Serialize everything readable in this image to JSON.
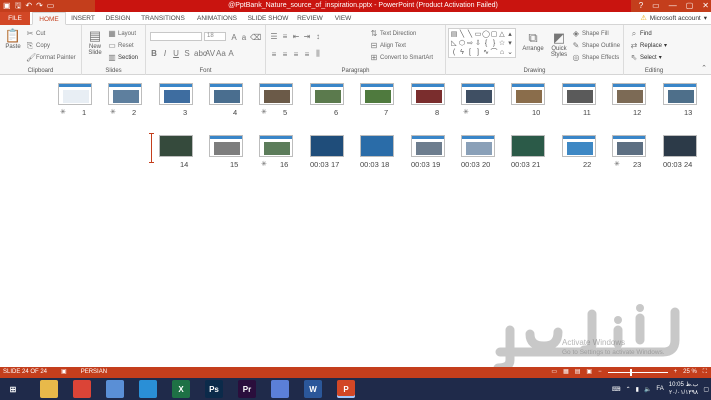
{
  "window": {
    "title": "@PptBank_Nature_source_of_inspiration.pptx - PowerPoint (Product Activation Failed)",
    "controls": [
      "?",
      "▭",
      "—",
      "▢",
      "✕"
    ]
  },
  "tabs": [
    "FILE",
    "HOME",
    "INSERT",
    "DESIGN",
    "TRANSITIONS",
    "ANIMATIONS",
    "SLIDE SHOW",
    "REVIEW",
    "VIEW"
  ],
  "active_tab": "HOME",
  "account_label": "Microsoft account",
  "ribbon": {
    "clipboard": {
      "label": "Clipboard",
      "paste": "Paste",
      "cut": "Cut",
      "copy": "Copy",
      "format_painter": "Format Painter"
    },
    "slides": {
      "label": "Slides",
      "new_slide": "New Slide",
      "layout": "Layout",
      "reset": "Reset",
      "section": "Section"
    },
    "font": {
      "label": "Font",
      "size": "18"
    },
    "paragraph": {
      "label": "Paragraph",
      "text_direction": "Text Direction",
      "align_text": "Align Text",
      "smartart": "Convert to SmartArt"
    },
    "drawing": {
      "label": "Drawing",
      "arrange": "Arrange",
      "quick_styles": "Quick Styles",
      "shape_fill": "Shape Fill",
      "shape_outline": "Shape Outline",
      "shape_effects": "Shape Effects"
    },
    "editing": {
      "label": "Editing",
      "find": "Find",
      "replace": "Replace",
      "select": "Select"
    }
  },
  "slides_row1": [
    {
      "num": "13",
      "theme": "light",
      "pic": "#4e6f8a"
    },
    {
      "num": "12",
      "theme": "light",
      "pic": "#7c6a55"
    },
    {
      "num": "11",
      "theme": "light",
      "pic": "#5a5a5a"
    },
    {
      "num": "10",
      "theme": "light",
      "pic": "#8a6d4b"
    },
    {
      "num": "9",
      "theme": "light",
      "pic": "#3f4f63",
      "star": true
    },
    {
      "num": "8",
      "theme": "light",
      "pic": "#7a2d2d"
    },
    {
      "num": "7",
      "theme": "light",
      "pic": "#4f7a3e"
    },
    {
      "num": "6",
      "theme": "light",
      "pic": "#5b7a4d"
    },
    {
      "num": "5",
      "theme": "light",
      "pic": "#6b5a48",
      "star": true
    },
    {
      "num": "4",
      "theme": "light",
      "pic": "#4a6e8f"
    },
    {
      "num": "3",
      "theme": "light",
      "pic": "#3e6da0"
    },
    {
      "num": "2",
      "theme": "light",
      "pic": "#5e7f9e",
      "star": true
    },
    {
      "num": "1",
      "theme": "light",
      "pic": "#e8eef4",
      "star": true
    }
  ],
  "slides_row2": [
    {
      "num": "24",
      "theme": "dark",
      "pic": "#2c3a48",
      "timing": "00:03"
    },
    {
      "num": "23",
      "theme": "light",
      "pic": "#5d6f82",
      "star": true
    },
    {
      "num": "22",
      "theme": "light",
      "pic": "#3e88c4"
    },
    {
      "num": "21",
      "theme": "dark",
      "pic": "#2b5a48",
      "timing": "00:03"
    },
    {
      "num": "20",
      "theme": "light",
      "pic": "#8aa0b8",
      "timing": "00:03"
    },
    {
      "num": "19",
      "theme": "light",
      "pic": "#6d7d8e",
      "timing": "00:03"
    },
    {
      "num": "18",
      "theme": "dark",
      "pic": "#2a6ca8",
      "timing": "00:03"
    },
    {
      "num": "17",
      "theme": "dark",
      "pic": "#1f4d7a",
      "timing": "00:03"
    },
    {
      "num": "16",
      "theme": "light",
      "pic": "#5c7c5a",
      "star": true
    },
    {
      "num": "15",
      "theme": "light",
      "pic": "#7d7d7d"
    },
    {
      "num": "14",
      "theme": "dark",
      "pic": "#354a3c"
    }
  ],
  "status": {
    "slide_info": "SLIDE 24 OF 24",
    "language": "PERSIAN",
    "zoom": "25 %"
  },
  "watermark": {
    "activate_line1": "Activate Windows",
    "activate_line2": "Go to Settings to activate Windows."
  },
  "taskbar": {
    "apps": [
      {
        "name": "file-explorer",
        "label": "",
        "color": "#e8b94a"
      },
      {
        "name": "chrome",
        "label": "",
        "color": "#db4437"
      },
      {
        "name": "remote",
        "label": "",
        "color": "#5a8fd6"
      },
      {
        "name": "refresh",
        "label": "",
        "color": "#2a8fd6"
      },
      {
        "name": "excel",
        "label": "X",
        "color": "#1e7145"
      },
      {
        "name": "photoshop",
        "label": "Ps",
        "color": "#0b2a4a"
      },
      {
        "name": "premiere",
        "label": "Pr",
        "color": "#2a0e3c"
      },
      {
        "name": "messenger",
        "label": "",
        "color": "#5b7fd8"
      },
      {
        "name": "word",
        "label": "W",
        "color": "#2b579a"
      },
      {
        "name": "powerpoint",
        "label": "P",
        "color": "#d24726",
        "active": true
      }
    ],
    "tray_lang": "FA",
    "time": "10:05 ب.ظ",
    "date": "۲۰/۰۱/۱۳۹۸"
  }
}
